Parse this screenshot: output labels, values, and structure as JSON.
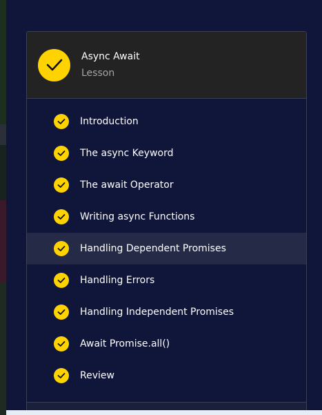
{
  "lesson": {
    "title": "Async Await",
    "subtitle": "Lesson",
    "status_icon": "check-circle-icon"
  },
  "items": [
    {
      "label": "Introduction",
      "completed": true
    },
    {
      "label": "The async Keyword",
      "completed": true
    },
    {
      "label": "The await Operator",
      "completed": true
    },
    {
      "label": "Writing async Functions",
      "completed": true
    },
    {
      "label": "Handling Dependent Promises",
      "completed": true,
      "active": true
    },
    {
      "label": "Handling Errors",
      "completed": true
    },
    {
      "label": "Handling Independent Promises",
      "completed": true
    },
    {
      "label": "Await Promise.all()",
      "completed": true
    },
    {
      "label": "Review",
      "completed": true
    }
  ],
  "colors": {
    "background": "#10153a",
    "header": "#232323",
    "accent": "#ffd300",
    "active_row": "#252a47",
    "border": "#3a3f5a"
  }
}
